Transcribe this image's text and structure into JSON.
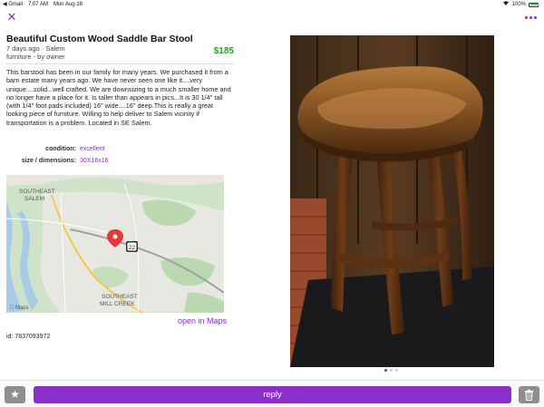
{
  "status_bar": {
    "carrier": "◀ Gmail",
    "time": "7:07 AM",
    "date": "Mon Aug 18",
    "battery": "100%",
    "battery_level": 1.0
  },
  "nav": {
    "close_icon": "close-icon",
    "more_icon": "more-icon"
  },
  "listing": {
    "title": "Beautiful Custom Wood Saddle Bar Stool",
    "posted": "7 days ago · Salem",
    "category": "furniture - by owner",
    "price": "$185",
    "description": "This barstool has been in our family for many years. We purchased it from a barn estate many years ago. We have never seen one like it....very unique....solid...well crafted. We are downsizing to a much smaller home and no longer have a place for it. Is taller than appears in pics...It is 30 1/4\" tall (with 1/4\" foot pads included) 16\" wide....16\" deep.This is really a great looking piece of furniture. Willing to help deliver to Salem vicinity if transportation is a problem. Located in SE Salem.",
    "attributes": [
      {
        "label": "condition:",
        "value": "excellent"
      },
      {
        "label": "size / dimensions:",
        "value": "30X16x16"
      }
    ],
    "post_id": "id: 7837093972"
  },
  "map": {
    "labels": [
      "SOUTHEAST",
      "SALEM",
      "SOUTHEAST",
      "MILL CREEK"
    ],
    "highway": "22",
    "attribution": "Maps",
    "open_link": "open in Maps"
  },
  "gallery": {
    "image_count": 3,
    "active_index": 0
  },
  "actions": {
    "reply_label": "reply",
    "star_icon": "star-icon",
    "trash_icon": "trash-icon"
  },
  "colors": {
    "accent": "#8b2fc9",
    "price": "#2e9e2e"
  }
}
